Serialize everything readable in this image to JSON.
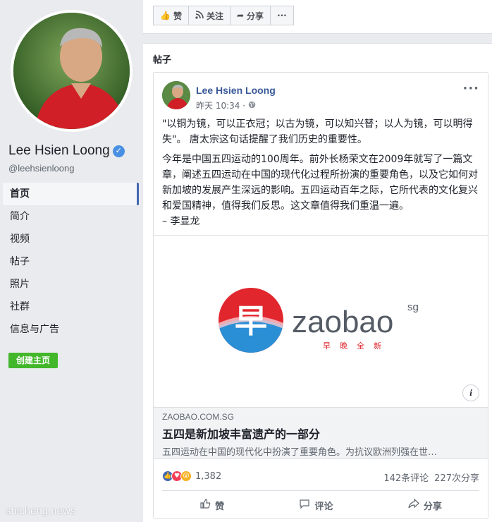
{
  "page": {
    "name": "Lee Hsien Loong",
    "handle": "@leehsienloong",
    "create_page_label": "创建主页"
  },
  "sidebar": {
    "items": [
      {
        "label": "首页",
        "active": true
      },
      {
        "label": "简介",
        "active": false
      },
      {
        "label": "视频",
        "active": false
      },
      {
        "label": "帖子",
        "active": false
      },
      {
        "label": "照片",
        "active": false
      },
      {
        "label": "社群",
        "active": false
      },
      {
        "label": "信息与广告",
        "active": false
      }
    ]
  },
  "topbar": {
    "like_label": "赞",
    "follow_label": "关注",
    "share_label": "分享",
    "more_label": "···"
  },
  "posts_section": {
    "title": "帖子"
  },
  "post": {
    "author": "Lee Hsien Loong",
    "time": "昨天 10:34 ·",
    "more_label": "···",
    "paragraph1": "\"以铜为镜，可以正衣冠；以古为镜，可以知兴替；以人为镜，可以明得失\"。 唐太宗这句话提醒了我们历史的重要性。",
    "paragraph2": "今年是中国五四运动的100周年。前外长杨荣文在2009年就写了一篇文章，阐述五四运动在中国的现代化过程所扮演的重要角色，以及它如何对新加坡的发展产生深远的影响。五四运动百年之际，它所代表的文化复兴和爱国精神，值得我们反思。这文章值得我们重温一遍。",
    "signature": "– 李显龙",
    "link": {
      "logo_char": "早",
      "logo_word": "zaobao",
      "logo_suffix": "sg",
      "logo_tagline": [
        "早",
        "晚",
        "全",
        "新"
      ],
      "info_icon": "i",
      "domain": "ZAOBAO.COM.SG",
      "title": "五四是新加坡丰富遗产的一部分",
      "description": "五四运动在中国的现代化中扮演了重要角色。为抗议欧洲列强在世…"
    },
    "reaction_count": "1,382",
    "comments": "142条评论",
    "shares": "227次分享",
    "actions": {
      "like": "赞",
      "comment": "评论",
      "share": "分享"
    }
  },
  "watermark": "shicheng.news",
  "colors": {
    "accent": "#4267b2",
    "create_button": "#42b72a",
    "zaobao_red": "#e1262d",
    "zaobao_blue": "#2b8fd6"
  },
  "icons": {
    "verified": "verified-badge-icon",
    "like": "thumbs-up-icon",
    "follow": "rss-icon",
    "share": "share-arrow-icon",
    "globe": "globe-icon",
    "comment": "comment-bubble-icon"
  }
}
